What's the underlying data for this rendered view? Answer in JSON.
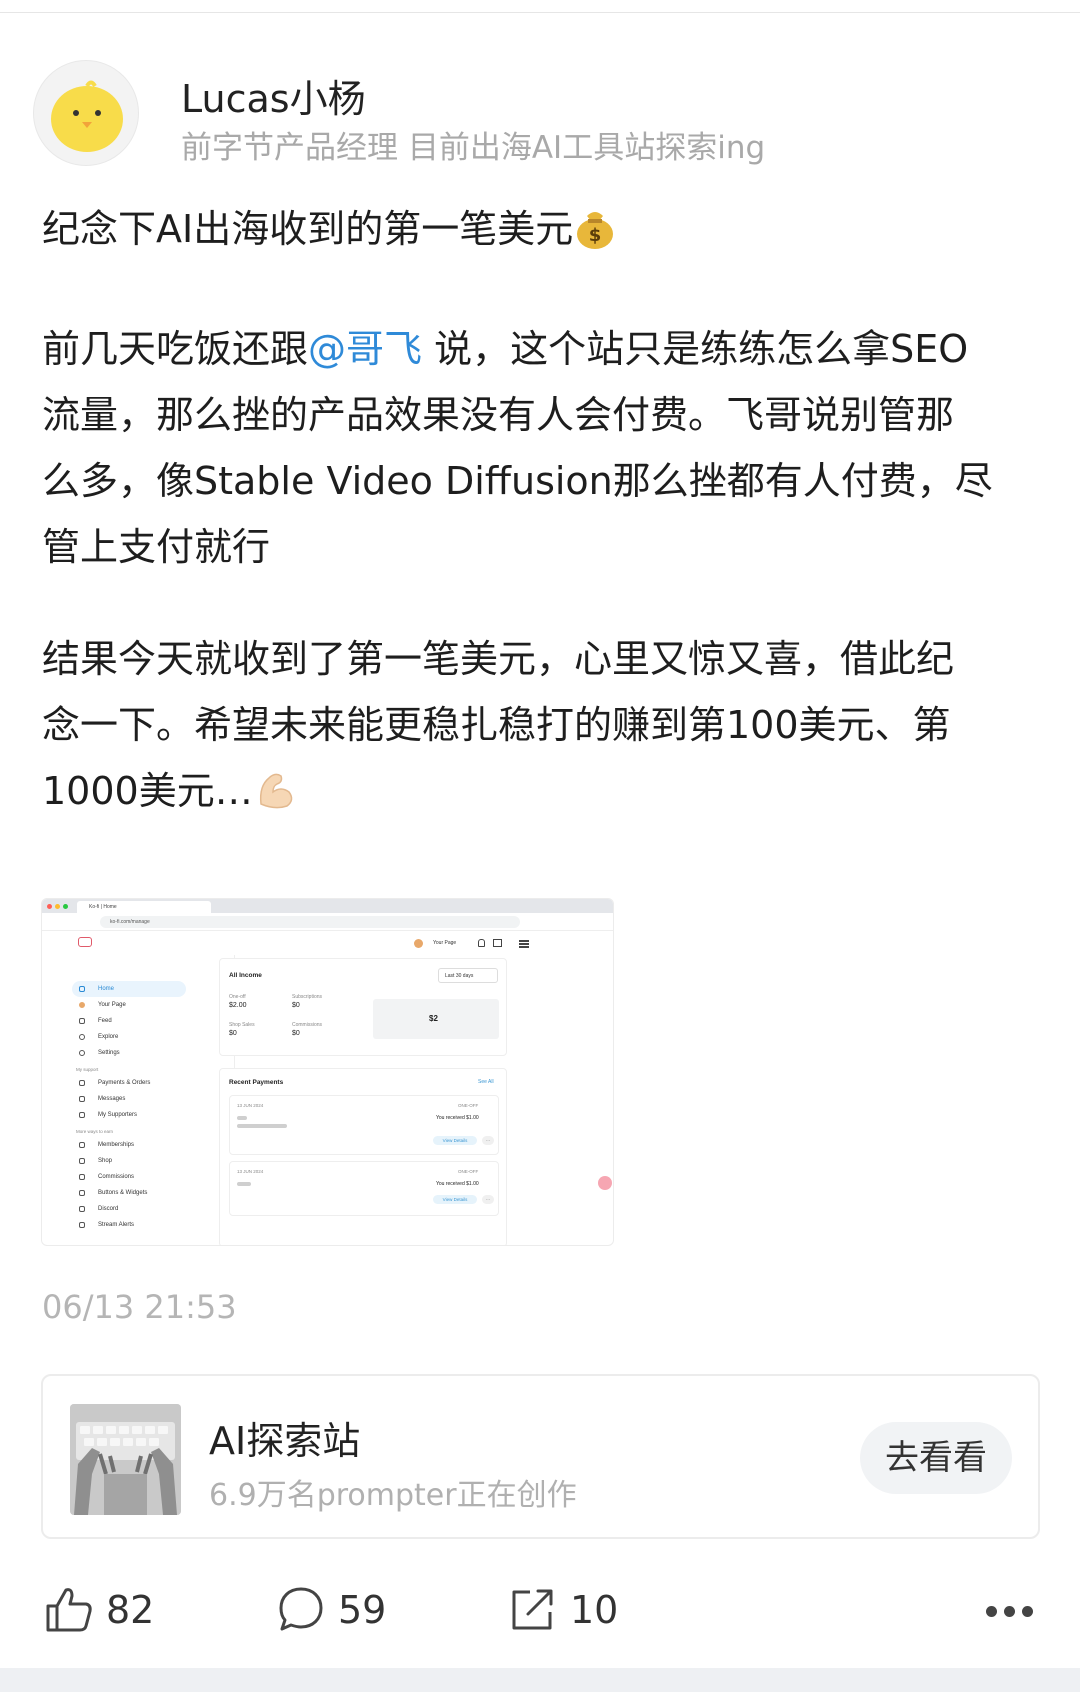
{
  "author": {
    "name": "Lucas小杨",
    "bio": "前字节产品经理  目前出海AI工具站探索ing",
    "avatar_icon": "yellow-chick-avatar"
  },
  "post": {
    "para1": "纪念下AI出海收到的第一笔美元",
    "para1_emoji": "money-bag-emoji",
    "para2_line1_before": "前几天吃饭还跟",
    "para2_mention": "@哥飞",
    "para2_line1_after": " 说，这个站只是练练怎么拿SEO",
    "para2_line2": "流量，那么挫的产品效果没有人会付费。飞哥说别管那",
    "para2_line3": "么多，像Stable Video Diffusion那么挫都有人付费，尽",
    "para2_line4": "管上支付就行",
    "para3_line1": "结果今天就收到了第一笔美元，心里又惊又喜，借此纪",
    "para3_line2": "念一下。希望未来能更稳扎稳打的赚到第100美元、第",
    "para3_line3": "1000美元…",
    "para3_emoji": "flexed-biceps-emoji"
  },
  "screenshot": {
    "tab_title": "Ko-fi | Home",
    "url": "ko-fi.com/manage",
    "your_page": "Your Page",
    "sidebar": [
      "Home",
      "Your Page",
      "Feed",
      "Explore",
      "Settings"
    ],
    "sidebar_head_1": "My support",
    "sidebar_2": [
      "Payments & Orders",
      "Messages",
      "My Supporters"
    ],
    "sidebar_head_2": "More ways to earn",
    "sidebar_3": [
      "Memberships",
      "Shop",
      "Commissions",
      "Buttons & Widgets",
      "Discord",
      "Stream Alerts"
    ],
    "income_title": "All Income",
    "range": "Last 30 days",
    "one_off_label": "One-off",
    "one_off_value": "$2.00",
    "subs_label": "Subscriptions",
    "subs_value": "$0",
    "shop_label": "Shop Sales",
    "shop_value": "$0",
    "comm_label": "Commissions",
    "comm_value": "$0",
    "total": "$2",
    "recent_title": "Recent Payments",
    "see_all": "See All",
    "payments": [
      {
        "date": "13 JUN 2024",
        "tag": "ONE-OFF",
        "text": "You received $1.00",
        "btn": "View Details"
      },
      {
        "date": "13 JUN 2024",
        "tag": "ONE-OFF",
        "text": "You received $1.00",
        "btn": "View Details"
      }
    ]
  },
  "timestamp": "06/13 21:53",
  "topic": {
    "title": "AI探索站",
    "subtitle": "6.9万名prompter正在创作",
    "button": "去看看"
  },
  "actions": {
    "likes": "82",
    "comments": "59",
    "shares": "10"
  },
  "colors": {
    "mention": "#2f8ad8",
    "muted": "#a9a9a9",
    "button_bg": "#f1f3f5"
  }
}
